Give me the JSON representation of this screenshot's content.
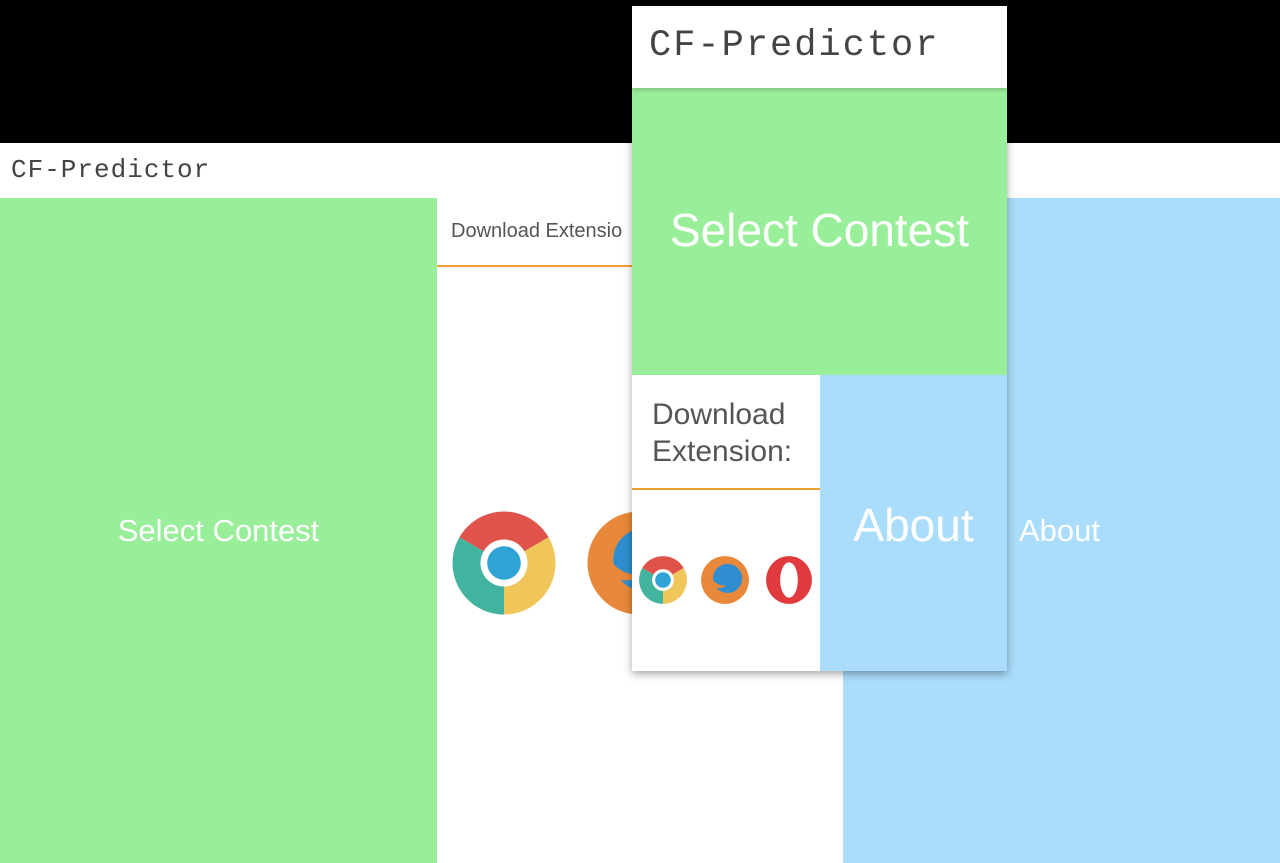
{
  "background_page": {
    "title": "CF-Predictor",
    "select_contest_label": "Select Contest",
    "download_label": "Download Extensio",
    "about_label": "About",
    "icons": [
      "chrome-icon",
      "firefox-icon"
    ]
  },
  "mobile_card": {
    "title": "CF-Predictor",
    "select_contest_label": "Select Contest",
    "download_label": "Download Extension:",
    "about_label": "About",
    "icons": [
      "chrome-icon",
      "firefox-icon",
      "opera-icon"
    ]
  },
  "colors": {
    "green": "#99ee99",
    "blue": "#aaddfb",
    "accent_line": "#f0a030",
    "title_text": "#444444"
  }
}
